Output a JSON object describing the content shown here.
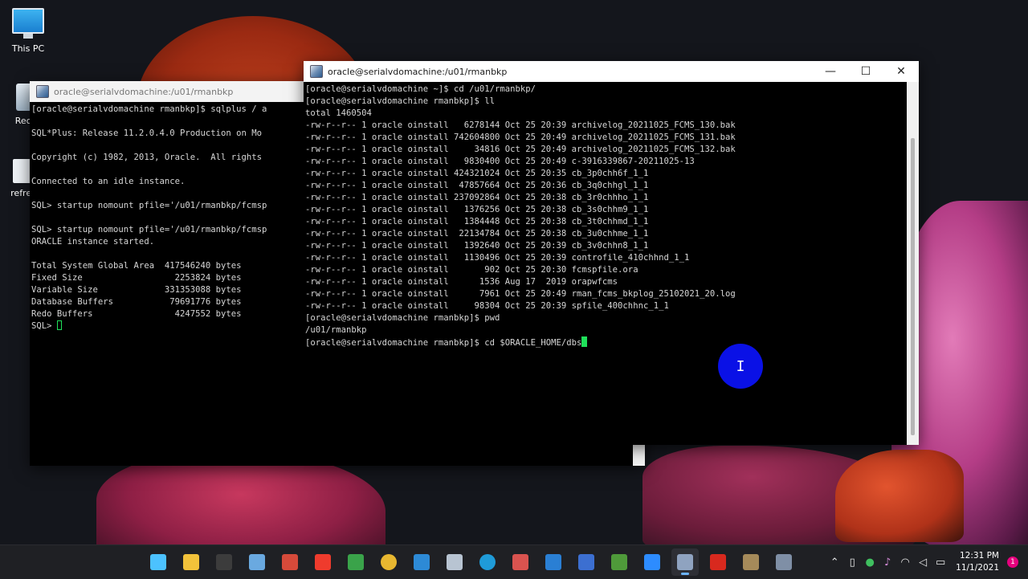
{
  "desktop": {
    "icons": [
      {
        "label": "This PC"
      },
      {
        "label": "Recyc"
      },
      {
        "label": "refres"
      }
    ]
  },
  "back_window": {
    "title": "oracle@serialvdomachine:/u01/rmanbkp",
    "lines": [
      "[oracle@serialvdomachine rmanbkp]$ sqlplus / a",
      "",
      "SQL*Plus: Release 11.2.0.4.0 Production on Mo",
      "",
      "Copyright (c) 1982, 2013, Oracle.  All rights",
      "",
      "Connected to an idle instance.",
      "",
      "SQL> startup nomount pfile='/u01/rmanbkp/fcmsp",
      "",
      "SQL> startup nomount pfile='/u01/rmanbkp/fcmsp",
      "ORACLE instance started.",
      "",
      "Total System Global Area  417546240 bytes",
      "Fixed Size                  2253824 bytes",
      "Variable Size             331353088 bytes",
      "Database Buffers           79691776 bytes",
      "Redo Buffers                4247552 bytes"
    ],
    "prompt": "SQL> "
  },
  "front_window": {
    "title": "oracle@serialvdomachine:/u01/rmanbkp",
    "controls": {
      "minimize": "—",
      "maximize": "☐",
      "close": "✕"
    },
    "lines": [
      "[oracle@serialvdomachine ~]$ cd /u01/rmanbkp/",
      "[oracle@serialvdomachine rmanbkp]$ ll",
      "total 1460504",
      "-rw-r--r-- 1 oracle oinstall   6278144 Oct 25 20:39 archivelog_20211025_FCMS_130.bak",
      "-rw-r--r-- 1 oracle oinstall 742604800 Oct 25 20:49 archivelog_20211025_FCMS_131.bak",
      "-rw-r--r-- 1 oracle oinstall     34816 Oct 25 20:49 archivelog_20211025_FCMS_132.bak",
      "-rw-r--r-- 1 oracle oinstall   9830400 Oct 25 20:49 c-3916339867-20211025-13",
      "-rw-r--r-- 1 oracle oinstall 424321024 Oct 25 20:35 cb_3p0chh6f_1_1",
      "-rw-r--r-- 1 oracle oinstall  47857664 Oct 25 20:36 cb_3q0chhgl_1_1",
      "-rw-r--r-- 1 oracle oinstall 237092864 Oct 25 20:38 cb_3r0chhho_1_1",
      "-rw-r--r-- 1 oracle oinstall   1376256 Oct 25 20:38 cb_3s0chhm9_1_1",
      "-rw-r--r-- 1 oracle oinstall   1384448 Oct 25 20:38 cb_3t0chhmd_1_1",
      "-rw-r--r-- 1 oracle oinstall  22134784 Oct 25 20:38 cb_3u0chhme_1_1",
      "-rw-r--r-- 1 oracle oinstall   1392640 Oct 25 20:39 cb_3v0chhn8_1_1",
      "-rw-r--r-- 1 oracle oinstall   1130496 Oct 25 20:39 controfile_410chhnd_1_1",
      "-rw-r--r-- 1 oracle oinstall       902 Oct 25 20:30 fcmspfile.ora",
      "-rw-r--r-- 1 oracle oinstall      1536 Aug 17  2019 orapwfcms",
      "-rw-r--r-- 1 oracle oinstall      7961 Oct 25 20:49 rman_fcms_bkplog_25102021_20.log",
      "-rw-r--r-- 1 oracle oinstall     98304 Oct 25 20:39 spfile_400chhnc_1_1",
      "[oracle@serialvdomachine rmanbkp]$ pwd",
      "/u01/rmanbkp"
    ],
    "current_command": "[oracle@serialvdomachine rmanbkp]$ cd $ORACLE_HOME/dbs"
  },
  "pointer": {
    "glyph": "I"
  },
  "taskbar": {
    "apps": [
      {
        "name": "start",
        "color": "#4cc2ff"
      },
      {
        "name": "file-explorer",
        "color": "#f2c23a"
      },
      {
        "name": "terminal",
        "color": "#3c3c3c"
      },
      {
        "name": "photos",
        "color": "#6aa9e0"
      },
      {
        "name": "slides",
        "color": "#d64a3a"
      },
      {
        "name": "anydesk",
        "color": "#ef3b2d"
      },
      {
        "name": "spreadsheet",
        "color": "#3aa34a"
      },
      {
        "name": "chrome",
        "color": "#e8b730"
      },
      {
        "name": "remote-desktop",
        "color": "#2d8ad6"
      },
      {
        "name": "virtualbox",
        "color": "#b8c4d2"
      },
      {
        "name": "edge",
        "color": "#1f9bd8"
      },
      {
        "name": "snipping",
        "color": "#d9534f"
      },
      {
        "name": "security",
        "color": "#2a7fd4"
      },
      {
        "name": "network-tool",
        "color": "#3c6fd1"
      },
      {
        "name": "game",
        "color": "#4f9a3a"
      },
      {
        "name": "zoom",
        "color": "#2d8cff"
      },
      {
        "name": "putty",
        "color": "#8fa3c0"
      },
      {
        "name": "acrobat",
        "color": "#d8291e"
      },
      {
        "name": "gimp",
        "color": "#a58a5a"
      },
      {
        "name": "cmd-tool",
        "color": "#7f8fa6"
      }
    ],
    "tray_icons": [
      "chevron-up-icon",
      "usb-icon",
      "network-drive-icon",
      "mic-icon",
      "wifi-icon",
      "volume-icon",
      "battery-icon"
    ],
    "time": "12:31 PM",
    "date": "11/1/2021",
    "notification_count": "1"
  }
}
